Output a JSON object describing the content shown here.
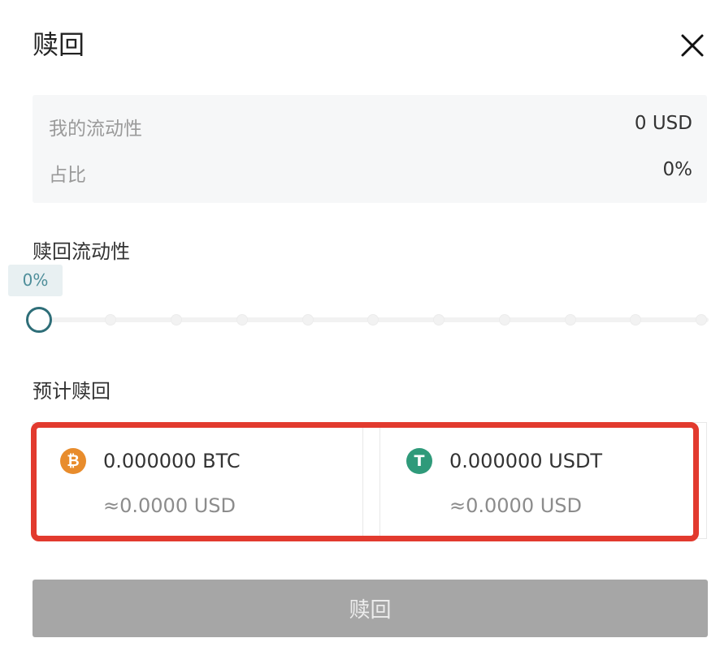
{
  "dialog": {
    "title": "赎回"
  },
  "summary": {
    "liquidity_label": "我的流动性",
    "liquidity_value": "0 USD",
    "share_label": "占比",
    "share_value": "0%"
  },
  "redeem": {
    "label": "赎回流动性",
    "percent_text": "0%",
    "percent": 0
  },
  "estimate": {
    "label": "预计赎回",
    "assets": [
      {
        "icon": "bitcoin-icon",
        "amount": "0.000000 BTC",
        "usd": "≈0.0000 USD",
        "color": "#e88c2c"
      },
      {
        "icon": "tether-icon",
        "amount": "0.000000 USDT",
        "usd": "≈0.0000 USD",
        "color": "#2f9a7a"
      }
    ]
  },
  "highlight_color": "#e23a2e",
  "submit_label": "赎回"
}
